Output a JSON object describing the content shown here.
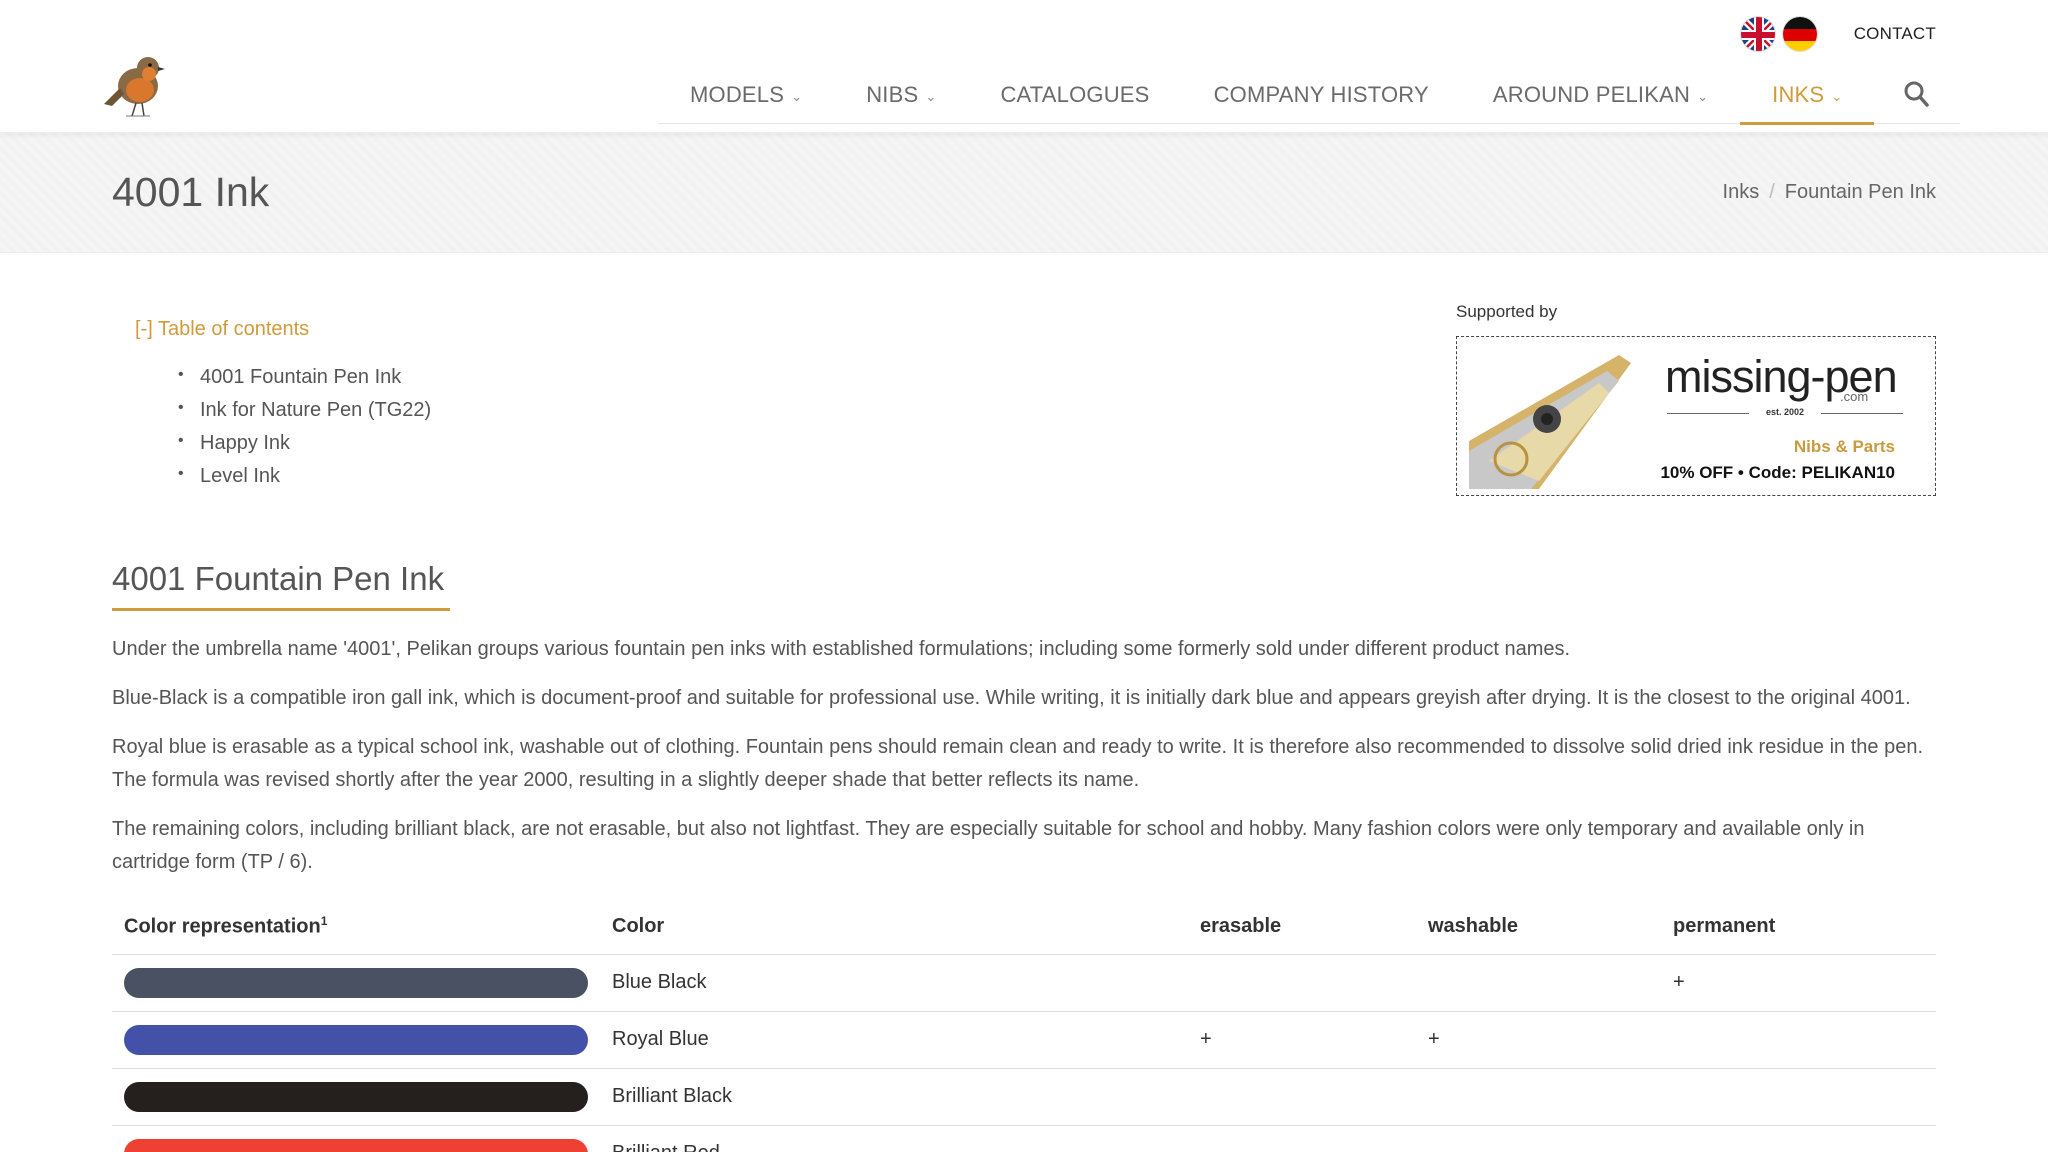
{
  "header": {
    "contact_label": "CONTACT",
    "nav": [
      {
        "label": "MODELS",
        "has_dropdown": true,
        "active": false
      },
      {
        "label": "NIBS",
        "has_dropdown": true,
        "active": false
      },
      {
        "label": "CATALOGUES",
        "has_dropdown": false,
        "active": false
      },
      {
        "label": "COMPANY HISTORY",
        "has_dropdown": false,
        "active": false
      },
      {
        "label": "AROUND PELIKAN",
        "has_dropdown": true,
        "active": false
      },
      {
        "label": "INKS",
        "has_dropdown": true,
        "active": true
      }
    ],
    "icons": {
      "logo": "robin-bird-logo",
      "flag_en": "uk-flag-icon",
      "flag_de": "german-flag-icon",
      "search": "search-icon",
      "chevron": "chevron-down-icon"
    }
  },
  "title_band": {
    "title": "4001 Ink",
    "breadcrumb": [
      "Inks",
      "Fountain Pen Ink"
    ]
  },
  "toc": {
    "title": "[-] Table of contents",
    "items": [
      "4001 Fountain Pen Ink",
      "Ink for Nature Pen (TG22)",
      "Happy Ink",
      "Level Ink"
    ]
  },
  "sponsor": {
    "label": "Supported by",
    "name": "missing-pen",
    "suffix": ".com",
    "est": "est. 2002",
    "tagline": "Nibs & Parts",
    "code": "10% OFF • Code: PELIKAN10"
  },
  "section": {
    "title": "4001 Fountain Pen Ink",
    "paragraphs": [
      "Under the umbrella name '4001', Pelikan groups various fountain pen inks with established formulations; including some formerly sold under different product names.",
      "Blue-Black is a compatible iron gall ink, which is document-proof and suitable for professional use. While writing, it is initially dark blue and appears greyish after drying. It is the closest to the original 4001.",
      "Royal blue is erasable as a typical school ink, washable out of clothing. Fountain pens should remain clean and ready to write. It is therefore also recommended to dissolve solid dried ink residue in the pen. The formula was revised shortly after the year 2000, resulting in a slightly deeper shade that better reflects its name.",
      "The remaining colors, including brilliant black, are not erasable, but also not lightfast. They are especially suitable for school and hobby. Many fashion colors were only temporary and available only in cartridge form (TP / 6)."
    ]
  },
  "table": {
    "headers": [
      "Color representation",
      "Color",
      "erasable",
      "washable",
      "permanent"
    ],
    "header_footnote": "1",
    "rows": [
      {
        "swatch": "#4a5163",
        "color": "Blue Black",
        "erasable": "",
        "washable": "",
        "permanent": "+"
      },
      {
        "swatch": "#4352a8",
        "color": "Royal Blue",
        "erasable": "+",
        "washable": "+",
        "permanent": ""
      },
      {
        "swatch": "#251f1e",
        "color": "Brilliant Black",
        "erasable": "",
        "washable": "",
        "permanent": ""
      },
      {
        "swatch": "#ee4033",
        "color": "Brilliant Red",
        "erasable": "",
        "washable": "",
        "permanent": ""
      }
    ]
  },
  "colors": {
    "accent": "#d09b3a",
    "text": "#555555"
  }
}
